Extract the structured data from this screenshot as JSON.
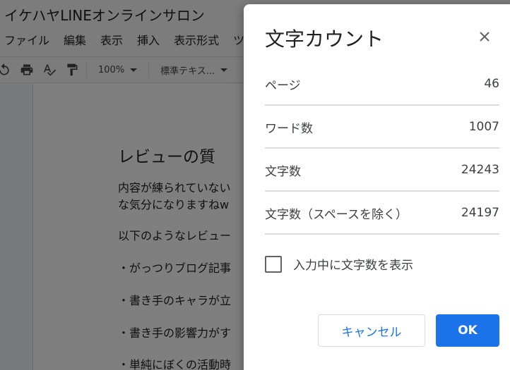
{
  "document": {
    "title": "イケハヤLINEオンラインサロン",
    "menu": [
      "ファイル",
      "編集",
      "表示",
      "挿入",
      "表示形式",
      "ツ"
    ],
    "toolbar": {
      "zoom": "100%",
      "style": "標準テキス..."
    },
    "heading": "レビューの質",
    "paragraphs": [
      "内容が練られていない",
      "な気分になりますねw",
      "以下のようなレビュー",
      "・がっつりブログ記事",
      "・書き手のキャラが立",
      "・書き手の影響力がす",
      "・単純にぼくの活動時"
    ]
  },
  "dialog": {
    "title": "文字カウント",
    "stats": [
      {
        "label": "ページ",
        "value": "46"
      },
      {
        "label": "ワード数",
        "value": "1007"
      },
      {
        "label": "文字数",
        "value": "24243"
      },
      {
        "label": "文字数（スペースを除く）",
        "value": "24197"
      }
    ],
    "checkbox_label": "入力中に文字数を表示",
    "checkbox_checked": false,
    "cancel_label": "キャンセル",
    "ok_label": "OK"
  }
}
